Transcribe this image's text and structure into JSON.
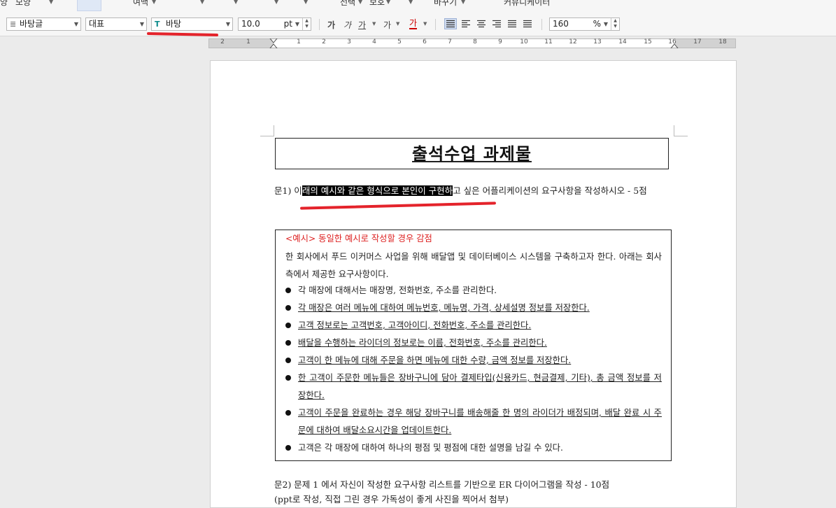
{
  "menu_row": {
    "items": [
      "양",
      "모양",
      "여백",
      "선택",
      "보호",
      "바꾸기",
      "커뮤니케이터"
    ]
  },
  "format_bar": {
    "style_value": "바탕글",
    "para_value": "대표",
    "font_value": "바탕",
    "size_value": "10.0",
    "size_unit": "pt",
    "bold_label": "가",
    "italic_label": "가",
    "underline_label": "가",
    "strike_label": "가",
    "color_label": "가",
    "line_spacing_value": "160",
    "line_spacing_unit": "%"
  },
  "ruler": {
    "numbers": [
      "2",
      "1",
      "1",
      "2",
      "3",
      "4",
      "5",
      "6",
      "7",
      "8",
      "9",
      "10",
      "11",
      "12",
      "13",
      "14",
      "15",
      "16",
      "17",
      "18"
    ]
  },
  "document": {
    "title": "출석수업 과제물",
    "q1_prefix": "문1) 이",
    "q1_selected": "래의 예시와 같은 형식으로 본인이 구현하",
    "q1_suffix": "고 싶은 어플리케이션의 요구사항을 작성하시오 - 5점",
    "example_title": "<예시> 동일한 예시로 작성할 경우 감점",
    "example_intro": "한 회사에서 푸드 이커머스 사업을 위해 배달앱 및 데이터베이스 시스템을 구축하고자 한다. 아래는 회사측에서 제공한 요구사항이다.",
    "example_items": [
      "각 매장에 대해서는 매장명, 전화번호, 주소를 관리한다.",
      "각 매장은 여러 메뉴에 대하여 메뉴번호, 메뉴명, 가격, 상세설명 정보를 저장한다.",
      "고객 정보로는 고객번호, 고객아이디, 전화번호, 주소를 관리한다.",
      "배달을 수행하는 라이더의 정보로는 이름, 전화번호, 주소를 관리한다.",
      "고객이 한 메뉴에 대해 주문을 하면 메뉴에 대한 수량, 금액 정보를 저장한다.",
      "한 고객이 주문한 메뉴들은 장바구니에 담아 결제타입(신용카드, 현금결제, 기타), 총 금액 정보를 저장한다.",
      "고객이 주문을 완료하는 경우 해당 장바구니를 배송해줄 한 명의 라이더가 배정되며, 배달 완료 시 주문에 대하여 배달소요시간을 업데이트한다.",
      "고객은 각 매장에 대하여 하나의 평점 및 평점에 대한 설명을 남길 수 있다."
    ],
    "q2_line1": "문2) 문제 1 에서 자신이 작성한 요구사항 리스트를 기반으로 ER 다이어그램을 작성 - 10점",
    "q2_line2": "(ppt로 작성, 직접 그린 경우 가독성이 좋게 사진을 찍어서 첨부)"
  },
  "colors": {
    "annotation_red": "#e4232b",
    "example_title_red": "#d22222",
    "selection_bg": "#000000"
  }
}
